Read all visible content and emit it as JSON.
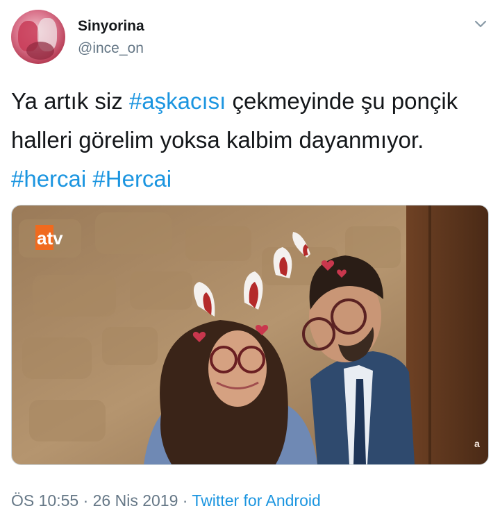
{
  "author": {
    "display_name": "Sinyorina",
    "handle": "@ince_on"
  },
  "tweet": {
    "segments": [
      {
        "text": "Ya artık siz ",
        "type": "text"
      },
      {
        "text": "#aşkacısı",
        "type": "hashtag"
      },
      {
        "text": " çekmeyinde şu ponçik halleri görelim yoksa kalbim dayanmıyor. ",
        "type": "text"
      },
      {
        "text": "#hercai",
        "type": "hashtag"
      },
      {
        "text": " ",
        "type": "text"
      },
      {
        "text": "#Hercai",
        "type": "hashtag"
      }
    ]
  },
  "media": {
    "channel_logo": "atv",
    "corner_logo": "a"
  },
  "meta": {
    "time": "ÖS 10:55",
    "separator": " · ",
    "date": "26 Nis 2019",
    "source": "Twitter for Android"
  },
  "icons": {
    "menu": "chevron-down-icon"
  },
  "colors": {
    "link": "#1b95e0",
    "secondary": "#657786",
    "text": "#14171a"
  }
}
